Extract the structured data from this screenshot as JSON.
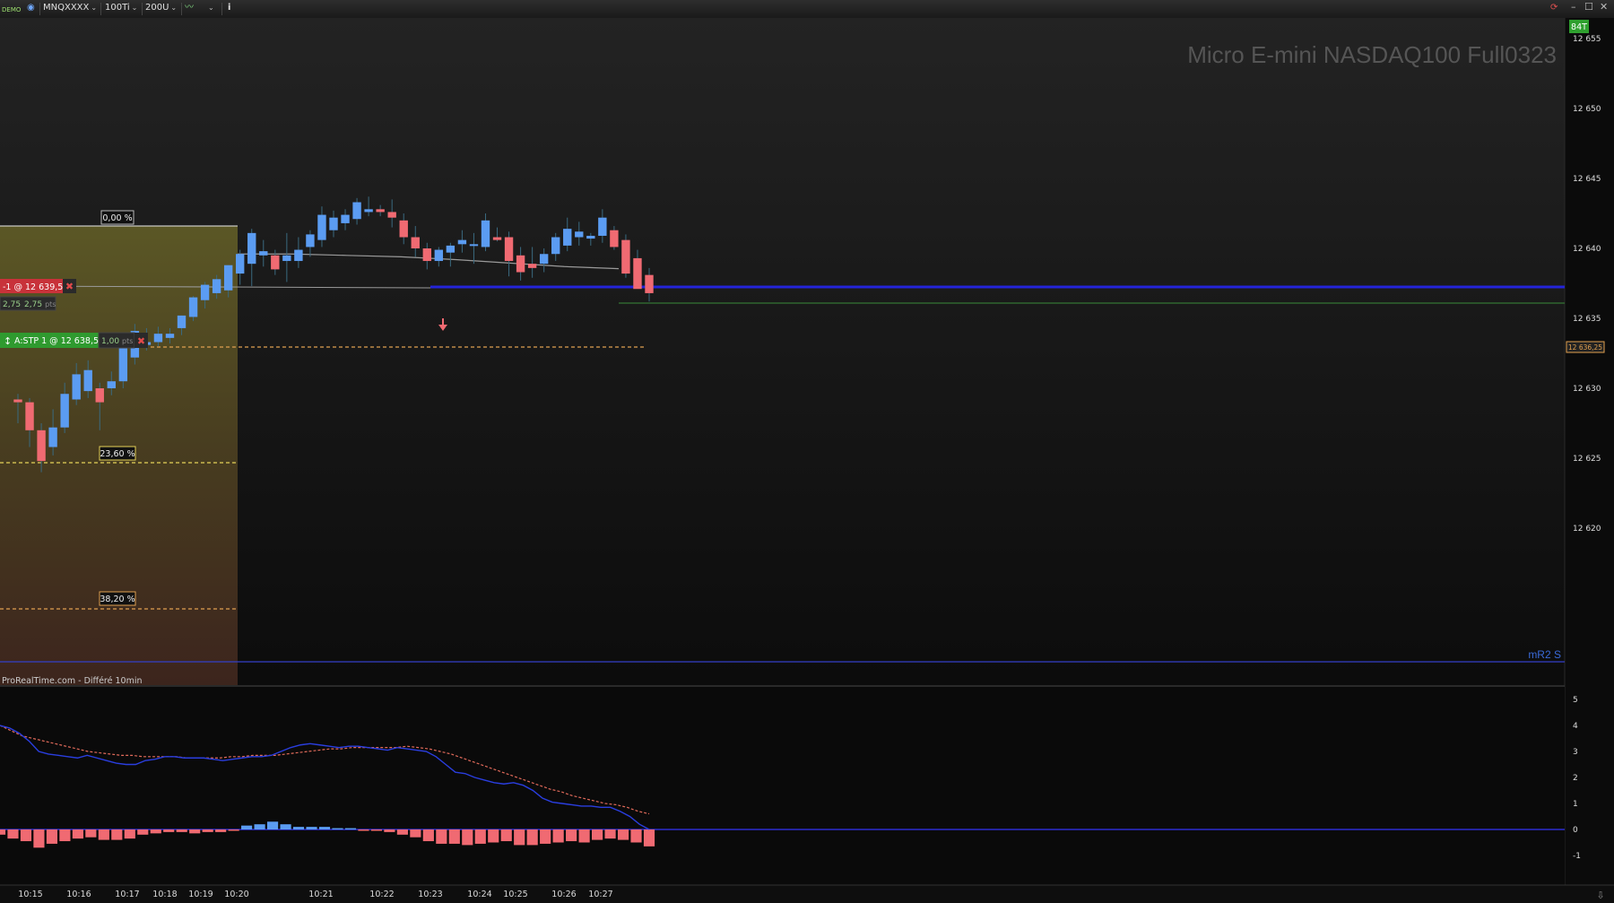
{
  "toolbar": {
    "demo_badge": "DEMO",
    "symbol": "MNQXXXX",
    "period": "100Ti",
    "units": "200U",
    "info": "i"
  },
  "chart": {
    "title": "Micro E-mini NASDAQ100 Full0323",
    "footer": "ProRealTime.com - Différé 10min",
    "ticker_badge": "84T",
    "mr2_label": "mR2 S",
    "last_price_label": "12 636,25",
    "fib_labels": [
      "0,00 %",
      "23,60 %",
      "38,20 %"
    ],
    "order1": {
      "text": "-1 @ 12 639,50"
    },
    "order_pts": {
      "a": "2,75",
      "b": "2,75",
      "unit": "pts"
    },
    "order2": {
      "text": "A:STP  1 @ 12 638,50",
      "pts": "1,00",
      "unit": "pts"
    },
    "price_ticks": [
      "12 655",
      "12 650",
      "12 645",
      "12 640",
      "12 635",
      "12 630",
      "12 625",
      "12 620"
    ],
    "osc_ticks": [
      "5",
      "4",
      "3",
      "2",
      "1",
      "0",
      "-1"
    ],
    "time_labels": [
      "10:15",
      "10:16",
      "10:17",
      "10:18",
      "10:19",
      "10:20",
      "10:21",
      "10:22",
      "10:23",
      "10:24",
      "10:25",
      "10:26",
      "10:27"
    ],
    "colors": {
      "up": "#5b9cf2",
      "down": "#f06a72",
      "line_blue": "#2424d8",
      "fib": "#d8c85a",
      "bg": "#151515"
    }
  },
  "chart_data": {
    "type": "candlestick",
    "price_range": [
      12617.5,
      12657.5
    ],
    "candles": [
      [
        12629.2,
        12629.6,
        12627.5,
        12629.0
      ],
      [
        12629.0,
        12629.3,
        12625.8,
        12627.0
      ],
      [
        12627.0,
        12627.5,
        12624.0,
        12624.8
      ],
      [
        12625.8,
        12628.5,
        12625.2,
        12627.2
      ],
      [
        12627.2,
        12630.4,
        12626.8,
        12629.6
      ],
      [
        12629.2,
        12631.8,
        12628.8,
        12631.0
      ],
      [
        12629.8,
        12632.0,
        12629.3,
        12631.3
      ],
      [
        12630.0,
        12630.4,
        12627.0,
        12629.0
      ],
      [
        12630.0,
        12631.2,
        12629.5,
        12630.5
      ],
      [
        12630.5,
        12633.9,
        12630.0,
        12633.3
      ],
      [
        12632.2,
        12634.6,
        12631.7,
        12634.1
      ],
      [
        12633.1,
        12634.3,
        12632.7,
        12633.3
      ],
      [
        12633.3,
        12634.4,
        12633.0,
        12633.9
      ],
      [
        12633.6,
        12634.3,
        12633.2,
        12633.9
      ],
      [
        12634.3,
        12635.2,
        12633.8,
        12635.2
      ],
      [
        12635.1,
        12636.6,
        12634.8,
        12636.5
      ],
      [
        12636.3,
        12637.6,
        12635.7,
        12637.4
      ],
      [
        12636.8,
        12638.1,
        12636.4,
        12637.8
      ],
      [
        12637.0,
        12638.8,
        12636.5,
        12638.8
      ],
      [
        12638.2,
        12639.9,
        12637.4,
        12639.6
      ],
      [
        12638.9,
        12641.4,
        12637.3,
        12641.1
      ],
      [
        12639.5,
        12640.6,
        12638.7,
        12639.8
      ],
      [
        12639.5,
        12639.9,
        12638.1,
        12638.5
      ],
      [
        12639.1,
        12641.1,
        12637.6,
        12639.5
      ],
      [
        12639.1,
        12640.8,
        12638.6,
        12639.9
      ],
      [
        12640.1,
        12641.3,
        12639.4,
        12641.0
      ],
      [
        12640.6,
        12643.0,
        12640.1,
        12642.4
      ],
      [
        12641.3,
        12642.7,
        12640.8,
        12642.2
      ],
      [
        12641.8,
        12642.8,
        12641.3,
        12642.4
      ],
      [
        12642.1,
        12643.6,
        12641.7,
        12643.3
      ],
      [
        12642.6,
        12643.7,
        12642.3,
        12642.8
      ],
      [
        12642.8,
        12643.1,
        12642.3,
        12642.6
      ],
      [
        12642.6,
        12643.5,
        12641.5,
        12642.2
      ],
      [
        12642.0,
        12642.5,
        12640.3,
        12640.8
      ],
      [
        12640.8,
        12641.6,
        12639.4,
        12640.0
      ],
      [
        12640.0,
        12640.4,
        12638.5,
        12639.1
      ],
      [
        12639.1,
        12640.1,
        12638.7,
        12639.9
      ],
      [
        12639.7,
        12640.4,
        12638.7,
        12640.2
      ],
      [
        12640.3,
        12641.3,
        12639.7,
        12640.6
      ],
      [
        12640.2,
        12641.1,
        12638.9,
        12640.3
      ],
      [
        12640.1,
        12642.5,
        12639.8,
        12642.0
      ],
      [
        12640.8,
        12641.5,
        12640.5,
        12640.6
      ],
      [
        12640.8,
        12641.2,
        12638.0,
        12639.1
      ],
      [
        12639.5,
        12640.1,
        12637.7,
        12638.3
      ],
      [
        12638.9,
        12640.1,
        12637.9,
        12638.6
      ],
      [
        12638.9,
        12640.0,
        12638.3,
        12639.6
      ],
      [
        12639.6,
        12641.1,
        12639.1,
        12640.8
      ],
      [
        12640.2,
        12642.2,
        12639.8,
        12641.4
      ],
      [
        12640.8,
        12641.9,
        12640.2,
        12641.2
      ],
      [
        12640.7,
        12641.1,
        12640.2,
        12640.9
      ],
      [
        12640.9,
        12642.8,
        12640.4,
        12642.2
      ],
      [
        12641.3,
        12641.6,
        12639.9,
        12640.1
      ],
      [
        12640.6,
        12641.0,
        12637.9,
        12638.2
      ],
      [
        12639.3,
        12639.9,
        12637.4,
        12637.1
      ],
      [
        12638.1,
        12638.6,
        12636.2,
        12636.8
      ]
    ],
    "ma_slow": [
      12639.6,
      12639.6,
      12639.5,
      12639.4,
      12639.2,
      12638.95,
      12638.7,
      12638.55
    ],
    "oscillator": {
      "blue": [
        4.0,
        3.9,
        3.7,
        3.4,
        3.0,
        2.9,
        2.85,
        2.8,
        2.75,
        2.85,
        2.75,
        2.65,
        2.55,
        2.5,
        2.5,
        2.65,
        2.7,
        2.8,
        2.8,
        2.75,
        2.75,
        2.75,
        2.7,
        2.65,
        2.7,
        2.75,
        2.8,
        2.8,
        2.85,
        3.0,
        3.15,
        3.25,
        3.3,
        3.25,
        3.2,
        3.15,
        3.2,
        3.2,
        3.15,
        3.1,
        3.05,
        3.15,
        3.1,
        3.05,
        3.0,
        2.8,
        2.5,
        2.2,
        2.15,
        2.0,
        1.9,
        1.8,
        1.75,
        1.8,
        1.7,
        1.5,
        1.2,
        1.05,
        1.0,
        0.95,
        0.9,
        0.9,
        0.85,
        0.85,
        0.7,
        0.5,
        0.2,
        0.0
      ],
      "red": [
        4.0,
        3.8,
        3.6,
        3.5,
        3.4,
        3.3,
        3.2,
        3.1,
        3.0,
        2.95,
        2.9,
        2.85,
        2.85,
        2.8,
        2.8,
        2.8,
        2.8,
        2.75,
        2.75,
        2.75,
        2.75,
        2.8,
        2.8,
        2.85,
        2.85,
        2.85,
        2.9,
        2.95,
        3.0,
        3.05,
        3.1,
        3.1,
        3.15,
        3.15,
        3.15,
        3.15,
        3.15,
        3.2,
        3.15,
        3.1,
        3.0,
        2.9,
        2.75,
        2.6,
        2.45,
        2.3,
        2.15,
        2.0,
        1.85,
        1.7,
        1.55,
        1.45,
        1.3,
        1.2,
        1.1,
        1.0,
        0.95,
        0.85,
        0.7,
        0.6
      ],
      "histogram": [
        -0.2,
        -0.35,
        -0.45,
        -0.7,
        -0.55,
        -0.45,
        -0.35,
        -0.3,
        -0.4,
        -0.4,
        -0.35,
        -0.2,
        -0.15,
        -0.1,
        -0.1,
        -0.15,
        -0.1,
        -0.1,
        -0.05,
        0.15,
        0.2,
        0.3,
        0.2,
        0.1,
        0.1,
        0.1,
        0.05,
        0.05,
        -0.05,
        -0.05,
        -0.1,
        -0.2,
        -0.3,
        -0.45,
        -0.55,
        -0.55,
        -0.6,
        -0.55,
        -0.5,
        -0.45,
        -0.6,
        -0.6,
        -0.55,
        -0.5,
        -0.45,
        -0.5,
        -0.4,
        -0.35,
        -0.4,
        -0.5,
        -0.65
      ]
    }
  }
}
